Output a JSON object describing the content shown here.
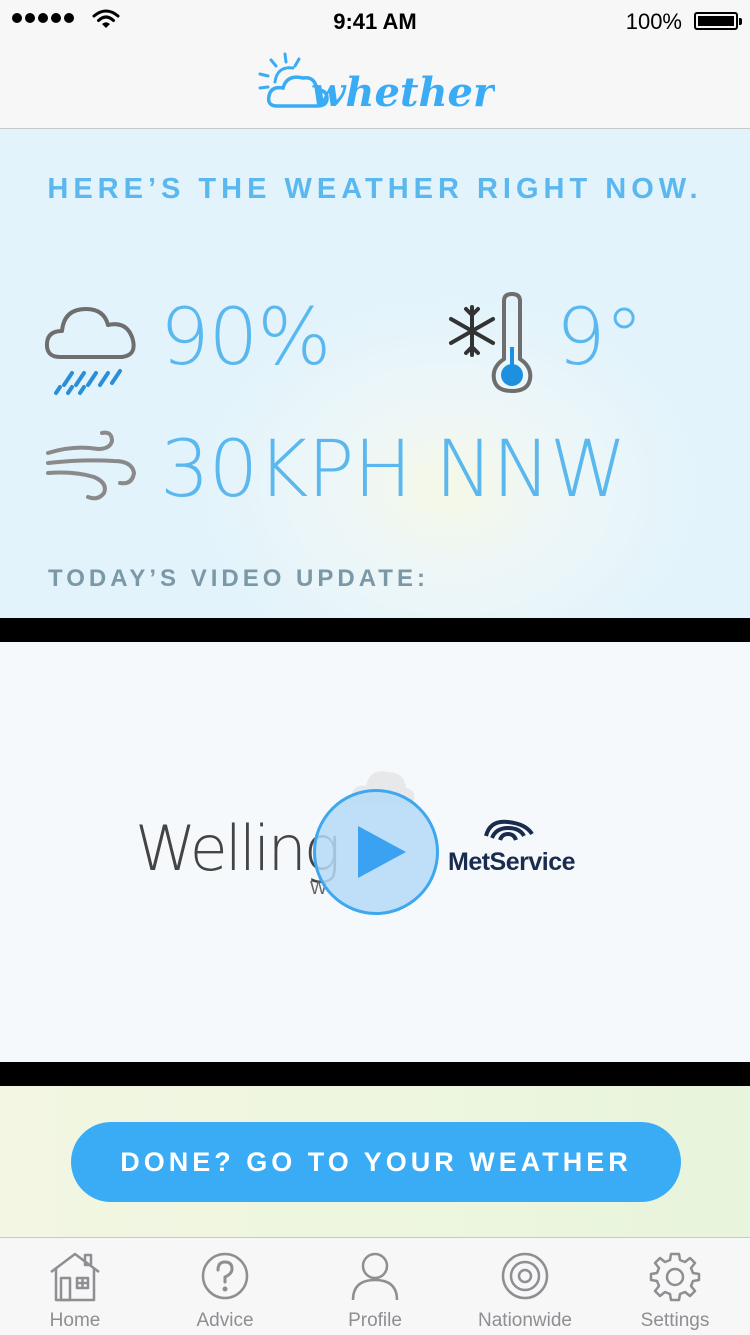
{
  "status_bar": {
    "time": "9:41 AM",
    "battery": "100%"
  },
  "header": {
    "logo_text": "whether?"
  },
  "weather": {
    "headline": "HERE’S THE WEATHER RIGHT NOW.",
    "rain_chance": "90%",
    "temperature": "9°",
    "wind": "30KPH NNW",
    "video_label": "TODAY’S VIDEO UPDATE:"
  },
  "video": {
    "thumbnail_text": "Welling",
    "thumbnail_small": "W",
    "brand": "MetService"
  },
  "cta": {
    "label": "DONE? GO TO YOUR WEATHER"
  },
  "tabs": [
    {
      "label": "Home",
      "icon": "home-icon"
    },
    {
      "label": "Advice",
      "icon": "question-icon"
    },
    {
      "label": "Profile",
      "icon": "person-icon"
    },
    {
      "label": "Nationwide",
      "icon": "radar-icon"
    },
    {
      "label": "Settings",
      "icon": "gear-icon"
    }
  ],
  "colors": {
    "accent": "#3aacf6",
    "text_blue": "#5ab8ef",
    "icon_gray": "#8e8e93"
  }
}
